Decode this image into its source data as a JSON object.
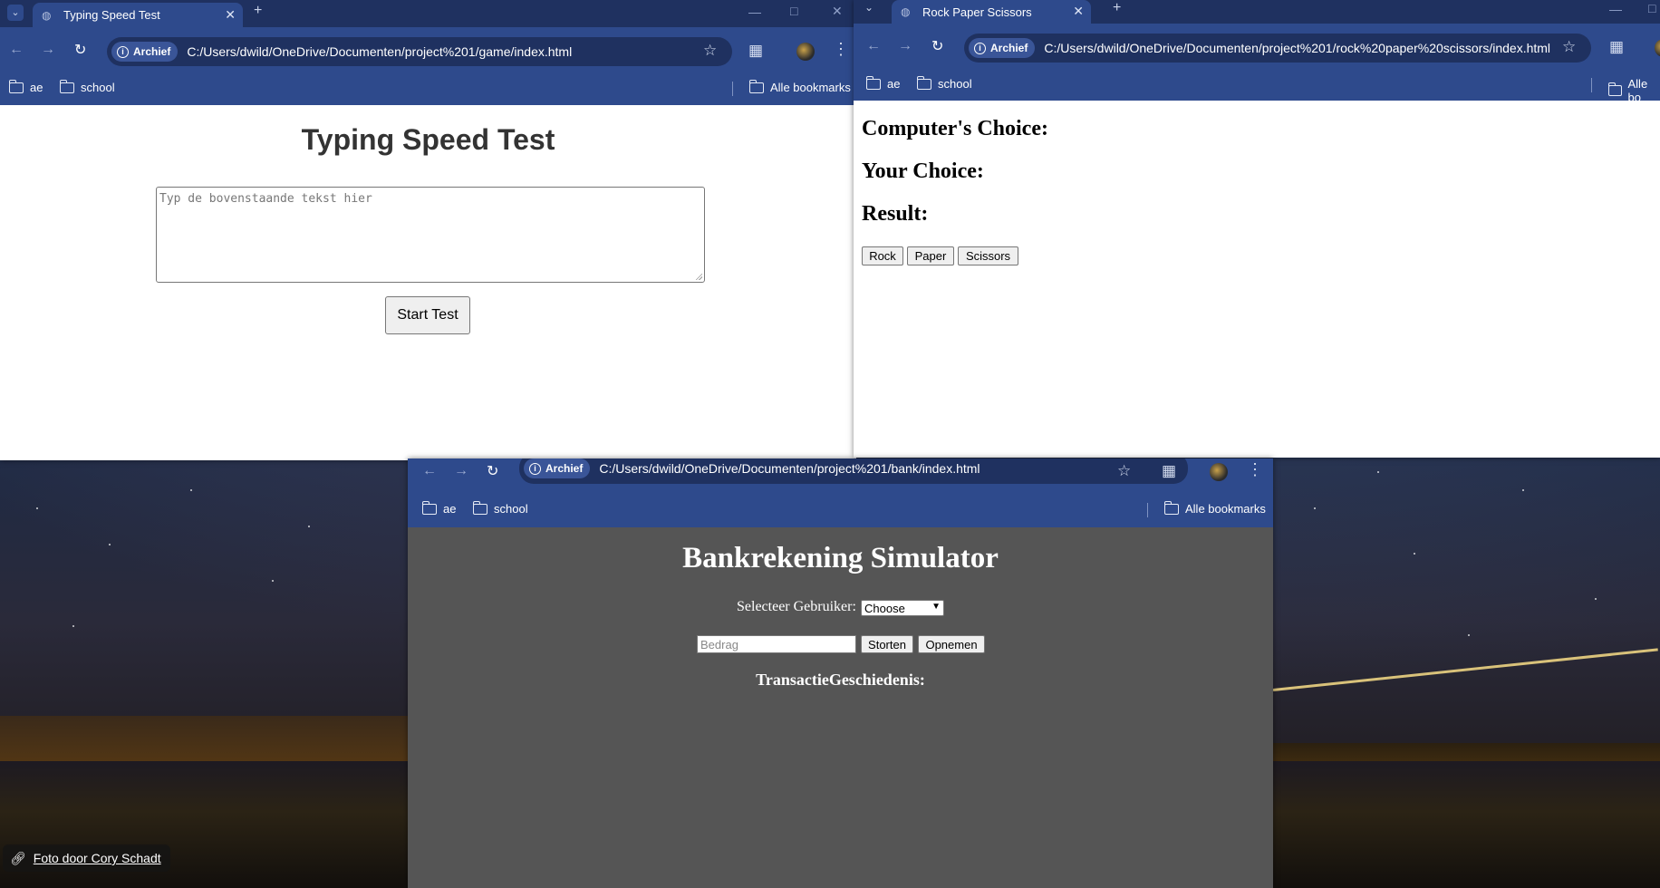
{
  "desktop": {
    "photo_credit": "Foto door Cory Schadt",
    "link_icon": "link-icon"
  },
  "typing_window": {
    "tab_title": "Typing Speed Test",
    "url": "C:/Users/dwild/OneDrive/Documenten/project%201/game/index.html",
    "page": {
      "title": "Typing Speed Test",
      "textarea_placeholder": "Typ de bovenstaande tekst hier",
      "start_button": "Start Test"
    }
  },
  "rps_window": {
    "tab_title": "Rock Paper Scissors",
    "url": "C:/Users/dwild/OneDrive/Documenten/project%201/rock%20paper%20scissors/index.html",
    "bookmarks_partial": "Alle bo",
    "page": {
      "computer_choice": "Computer's Choice:",
      "your_choice": "Your Choice:",
      "result": "Result:",
      "buttons": [
        "Rock",
        "Paper",
        "Scissors"
      ]
    }
  },
  "bank_window": {
    "url": "C:/Users/dwild/OneDrive/Documenten/project%201/bank/index.html",
    "page": {
      "title": "Bankrekening Simulator",
      "select_label": "Selecteer Gebruiker:",
      "select_value": "Choose",
      "amount_placeholder": "Bedrag",
      "deposit_button": "Storten",
      "withdraw_button": "Opnemen",
      "history_title": "TransactieGeschiedenis:"
    }
  },
  "browser_common": {
    "chip_label": "Archief",
    "bookmarks": [
      "ae",
      "school"
    ],
    "all_bookmarks": "Alle bookmarks"
  }
}
